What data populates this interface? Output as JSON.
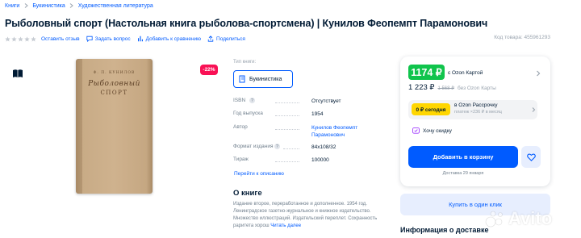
{
  "breadcrumb": {
    "items": [
      "Книги",
      "Букинистика",
      "Художественная литература"
    ]
  },
  "product": {
    "title": "Рыболовный спорт (Настольная книга рыболова-спортсмена) | Кунилов Феопемпт Парамонович",
    "sku": "Код товара: 455961293",
    "rating_stars": 0,
    "discount_badge": "-22%"
  },
  "meta_actions": {
    "reviews": "Оставить отзыв",
    "question": "Задать вопрос",
    "compare": "Добавить к сравнению",
    "share": "Поделиться"
  },
  "cover": {
    "author": "Ф. П. КУНИЛОВ",
    "title_line1": "Рыболовный",
    "title_line2": "СПОРТ"
  },
  "characteristics": {
    "type_label": "Тип книги:",
    "type_value": "Букинистика",
    "specs": [
      {
        "key": "ISBN",
        "value": "Отсутствует",
        "link": false
      },
      {
        "key": "Год выпуска",
        "value": "1954",
        "link": false
      },
      {
        "key": "Автор",
        "value": "Кунилов Феопемпт Парамонович",
        "link": true
      },
      {
        "key": "Формат издания",
        "value": "84x108/32",
        "link": false
      },
      {
        "key": "Тираж",
        "value": "100000",
        "link": false
      }
    ],
    "goto_description": "Перейти к описанию"
  },
  "about": {
    "heading": "О книге",
    "text": "Издание второе, переработанное и дополненное. 1954 год. Ленинградское газетно-журнальное и книжное издательство. Множество иллюстраций. Издательский переплет. Сохранность раритета хорош",
    "more": "Читать далее"
  },
  "pricing": {
    "ozon_price": "1174 ₽",
    "ozon_label": "с Ozon Картой",
    "price": "1 223 ₽",
    "old_price": "1 568 ₽",
    "no_card_label": "без Ozon Карты",
    "installment_badge": "0 ₽ сегодня",
    "installment_title": "в Ozon Рассрочку",
    "installment_sub": "платеж ×236 ₽ в месяц",
    "want_discount": "Хочу скидку",
    "add_to_cart": "Добавить в корзину",
    "delivery_date": "Доставка 29 января",
    "buy_one_click": "Купить в один клик",
    "delivery_info": "Информация о доставке"
  },
  "colors": {
    "accent": "#005bff",
    "ozon_green": "#10c44c",
    "discount_red": "#f91155",
    "installment_yellow": "#ffd600"
  },
  "watermark": "Avito"
}
